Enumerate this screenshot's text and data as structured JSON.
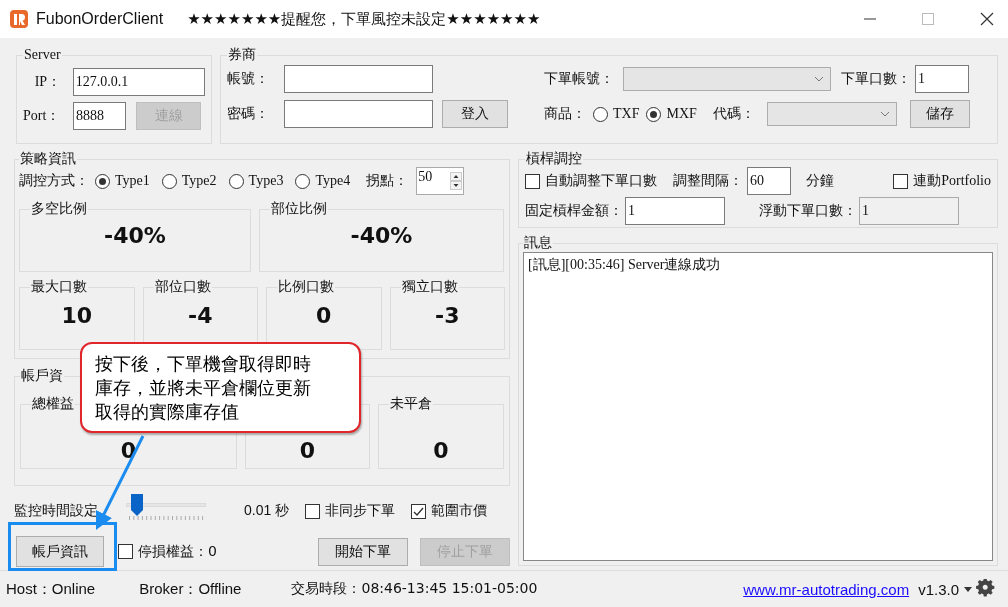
{
  "window": {
    "title": "FubonOrderClient",
    "notice": "★★★★★★★提醒您，下單風控未設定★★★★★★★"
  },
  "server": {
    "title": "Server",
    "ip_label": "IP：",
    "ip": "127.0.0.1",
    "port_label": "Port：",
    "port": "8888",
    "connect_button": {
      "label": "連線",
      "disabled": true
    }
  },
  "broker": {
    "title": "券商",
    "account_label": "帳號：",
    "password_label": "密碼：",
    "login_button": "登入",
    "order_account_label": "下單帳號：",
    "lots_label": "下單口數：",
    "lots": "1",
    "product_label": "商品：",
    "products": [
      {
        "label": "TXF",
        "selected": false
      },
      {
        "label": "MXF",
        "selected": true
      }
    ],
    "code_label": "代碼：",
    "save_button": "儲存"
  },
  "strategy": {
    "title": "策略資訊",
    "mode_label": "調控方式：",
    "modes": [
      {
        "label": "Type1",
        "selected": true
      },
      {
        "label": "Type2",
        "selected": false
      },
      {
        "label": "Type3",
        "selected": false
      },
      {
        "label": "Type4",
        "selected": false
      }
    ],
    "slip_label": "拐點：",
    "slip": "50",
    "ratios": [
      {
        "label": "多空比例",
        "value": "-40%"
      },
      {
        "label": "部位比例",
        "value": "-40%"
      }
    ],
    "counts": [
      {
        "label": "最大口數",
        "value": "10"
      },
      {
        "label": "部位口數",
        "value": "-4"
      },
      {
        "label": "比例口數",
        "value": "0"
      },
      {
        "label": "獨立口數",
        "value": "-3"
      }
    ]
  },
  "account": {
    "title": "帳戶資",
    "boxes": [
      {
        "label": "總權益",
        "value": "0"
      },
      {
        "value": "0"
      },
      {
        "label": "未平倉",
        "value": "0"
      }
    ]
  },
  "controls": {
    "monitor_label": "監控時間設定",
    "monitor": {
      "level": 0.05
    },
    "monitor_reading": "0.01 秒",
    "async": {
      "label": "非同步下單",
      "checked": false
    },
    "range_price": {
      "label": "範圍市價",
      "checked": true
    },
    "account_button": "帳戶資訊",
    "stop_loss": {
      "label": "停損權益：0",
      "checked": false
    },
    "start_button": {
      "label": "開始下單",
      "disabled": false
    },
    "stop_button": {
      "label": "停止下單",
      "disabled": true
    }
  },
  "leverage": {
    "title": "槓桿調控",
    "auto_adjust": {
      "label": "自動調整下單口數",
      "checked": false
    },
    "interval_label": "調整間隔：",
    "interval": "60",
    "interval_unit": "分鐘",
    "portfolio": {
      "label": "連動Portfolio",
      "checked": false
    },
    "fixed_label": "固定槓桿金額：",
    "fixed": "1",
    "float_label": "浮動下單口數：",
    "float": "1"
  },
  "messages": {
    "title": "訊息",
    "lines": [
      "[訊息][00:35:46] Server連線成功"
    ]
  },
  "callout": {
    "text": "按下後，下單機會取得即時庫存，並將未平倉欄位更新取得的實際庫存值"
  },
  "status_bar": {
    "host": "Host：Online",
    "broker": "Broker：Offline",
    "session": "交易時段：08:46-13:45 15:01-05:00",
    "link": "www.mr-autotrading.com",
    "version": "v1.3.0"
  }
}
